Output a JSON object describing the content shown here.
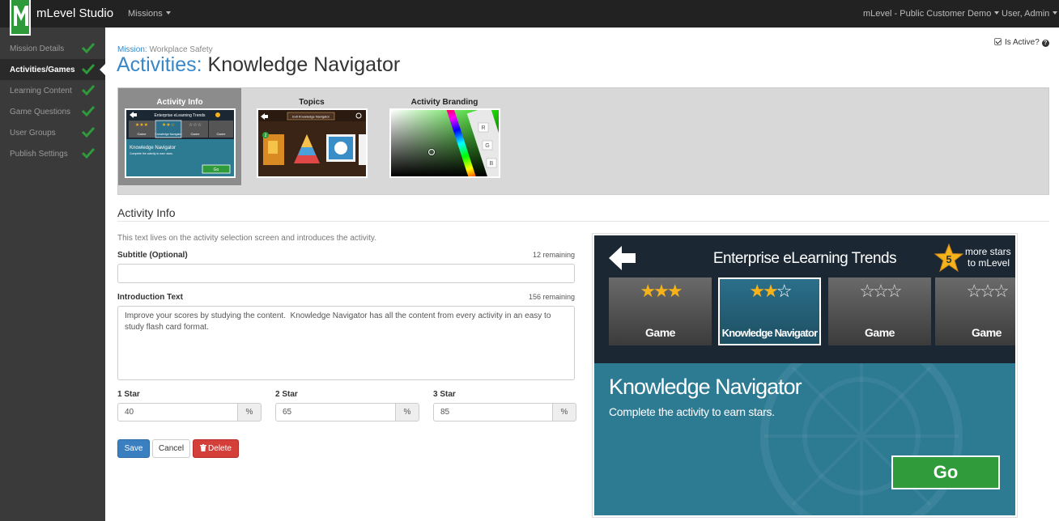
{
  "topbar": {
    "brand": "mLevel Studio",
    "missions_menu": "Missions",
    "org_menu": "mLevel - Public Customer Demo",
    "user_menu": "User, Admin"
  },
  "sidebar": {
    "items": [
      {
        "label": "Mission Details",
        "complete": true,
        "active": false
      },
      {
        "label": "Activities/Games",
        "complete": true,
        "active": true
      },
      {
        "label": "Learning Content",
        "complete": true,
        "active": false
      },
      {
        "label": "Game Questions",
        "complete": true,
        "active": false
      },
      {
        "label": "User Groups",
        "complete": true,
        "active": false
      },
      {
        "label": "Publish Settings",
        "complete": true,
        "active": false
      }
    ]
  },
  "header": {
    "mission_label": "Mission:",
    "mission_name": "Workplace Safety",
    "title_prefix": "Activities:",
    "title_name": "Knowledge Navigator",
    "is_active_label": "Is Active?",
    "is_active": true
  },
  "tabs": [
    {
      "label": "Activity Info",
      "selected": true
    },
    {
      "label": "Topics",
      "selected": false
    },
    {
      "label": "Activity Branding",
      "selected": false
    }
  ],
  "form": {
    "section_title": "Activity Info",
    "help_text": "This text lives on the activity selection screen and introduces the activity.",
    "subtitle_label": "Subtitle (Optional)",
    "subtitle_remaining": "12 remaining",
    "subtitle_value": "",
    "intro_label": "Introduction Text",
    "intro_remaining": "156 remaining",
    "intro_value": "Improve your scores by studying the content.  Knowledge Navigator has all the content from every activity in an easy to study flash card format.",
    "star1_label": "1 Star",
    "star1_value": "40",
    "star2_label": "2 Star",
    "star2_value": "65",
    "star3_label": "3 Star",
    "star3_value": "85",
    "percent": "%",
    "save_label": "Save",
    "cancel_label": "Cancel",
    "delete_label": "Delete"
  },
  "preview": {
    "title": "Enterprise eLearning Trends",
    "stars_badge": "5",
    "more_stars": "more stars",
    "to_mlevel": "to mLevel",
    "cards": [
      {
        "label": "Game",
        "stars": 3
      },
      {
        "label": "Knowledge Navigator",
        "stars": 2
      },
      {
        "label": "Game",
        "stars": 0
      },
      {
        "label": "Game",
        "stars": 0
      }
    ],
    "heading": "Knowledge Navigator",
    "subheading": "Complete the activity to earn stars.",
    "go_label": "Go"
  },
  "thumbs": {
    "topics_header": "Exit Knowledge Navigator",
    "topics_badge": "2",
    "branding_keys": [
      "R",
      "G",
      "B"
    ]
  },
  "colors": {
    "accent_blue": "#3a87c8",
    "success_green": "#2f9b3a",
    "danger_red": "#d43f3a",
    "sidebar_bg": "#3a3a3a",
    "topbar_bg": "#222222"
  }
}
